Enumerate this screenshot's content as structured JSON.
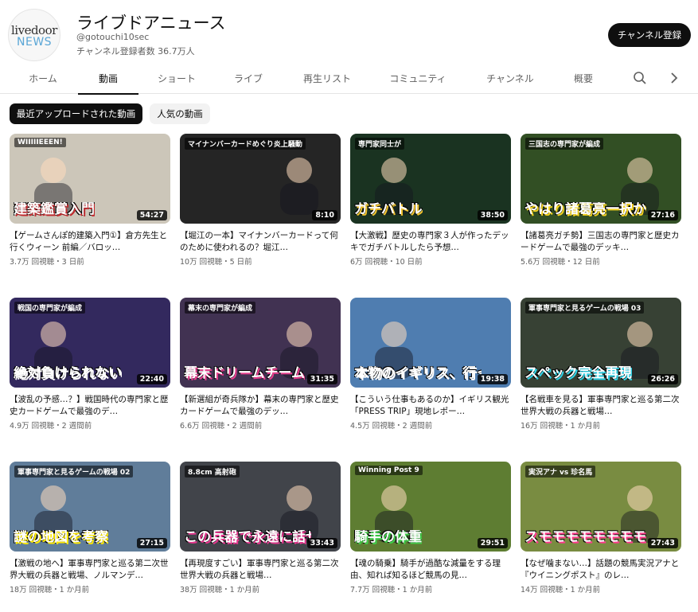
{
  "channel": {
    "logo_line1": "livedoor",
    "logo_line2": "NEWS",
    "name": "ライブドアニュース",
    "handle": "@gotouchi10sec",
    "subscribers": "チャンネル登録者数 36.7万人",
    "subscribe_label": "チャンネル登録"
  },
  "tabs": [
    {
      "label": "ホーム",
      "active": false
    },
    {
      "label": "動画",
      "active": true
    },
    {
      "label": "ショート",
      "active": false
    },
    {
      "label": "ライブ",
      "active": false
    },
    {
      "label": "再生リスト",
      "active": false
    },
    {
      "label": "コミュニティ",
      "active": false
    },
    {
      "label": "チャンネル",
      "active": false
    },
    {
      "label": "概要",
      "active": false
    }
  ],
  "icons": {
    "search": "search-icon",
    "next": "chevron-right-icon"
  },
  "chips": [
    {
      "label": "最近アップロードされた動画",
      "selected": true
    },
    {
      "label": "人気の動画",
      "selected": false
    }
  ],
  "videos": [
    {
      "title": "【ゲームさんぽ的建築入門①】倉方先生と行くウィーン 前編／バロッ…",
      "meta": "3.7万 回視聴・3 日前",
      "duration": "54:27",
      "thumb_text": "建築鑑賞入門",
      "thumb_top": "WIIIIIEEEN!",
      "thumb_bg": "#e9e2d3",
      "thumb_accent": "#c0282d"
    },
    {
      "title": "【堀江の一本】マイナンバーカードって何のために使われるの？堀江…",
      "meta": "10万 回視聴・5 日前",
      "duration": "8:10",
      "thumb_text": "",
      "thumb_top": "マイナンバーカードめぐり炎上騒動",
      "thumb_bg": "#2b2b2b",
      "thumb_accent": "#e5e5e5"
    },
    {
      "title": "【大激戦】歴史の専門家３人が作ったデッキでガチバトルしたら予想…",
      "meta": "6万 回視聴・10 日前",
      "duration": "38:50",
      "thumb_text": "ガチバトル",
      "thumb_top": "専門家同士が",
      "thumb_bg": "#1e3b26",
      "thumb_accent": "#f2c22e"
    },
    {
      "title": "【諸葛亮ガチ勢】三国志の専門家と歴史カードゲームで最強のデッキ…",
      "meta": "5.6万 回視聴・12 日前",
      "duration": "27:16",
      "thumb_text": "やはり諸葛亮一択か",
      "thumb_top": "三国志の専門家が編成",
      "thumb_bg": "#3a5a2a",
      "thumb_accent": "#f5d21f"
    },
    {
      "title": "【波乱の予感…？】戦国時代の専門家と歴史カードゲームで最強のデ…",
      "meta": "4.9万 回視聴・2 週間前",
      "duration": "22:40",
      "thumb_text": "絶対負けられない",
      "thumb_top": "戦国の専門家が編成",
      "thumb_bg": "#3b2f6b",
      "thumb_accent": "#ffffff"
    },
    {
      "title": "【新選組が奇兵隊か】幕末の専門家と歴史カードゲームで最強のデッ…",
      "meta": "6.6万 回視聴・2 週間前",
      "duration": "31:35",
      "thumb_text": "幕末ドリームチーム",
      "thumb_top": "幕末の専門家が編成",
      "thumb_bg": "#4a3a5e",
      "thumb_accent": "#e83d8d"
    },
    {
      "title": "【こういう仕事もあるのか】イギリス観光「PRESS TRIP」現地レポー…",
      "meta": "4.5万 回視聴・2 週間前",
      "duration": "19:38",
      "thumb_text": "本物のイギリス、行って来ました。",
      "thumb_top": "",
      "thumb_bg": "#5b8fc9",
      "thumb_accent": "#ffffff"
    },
    {
      "title": "【名戦車を見る】軍事専門家と巡る第二次世界大戦の兵器と戦場…",
      "meta": "16万 回視聴・1 か月前",
      "duration": "26:26",
      "thumb_text": "スペック完全再現",
      "thumb_top": "軍事専門家と見るゲームの戦場 03",
      "thumb_bg": "#3f4a3c",
      "thumb_accent": "#2fd3e8"
    },
    {
      "title": "【激戦の地へ】軍事専門家と巡る第二次世界大戦の兵器と戦場、ノルマンデ…",
      "meta": "18万 回視聴・1 か月前",
      "duration": "27:15",
      "thumb_text": "謎の地図を考察",
      "thumb_top": "軍事専門家と見るゲームの戦場 02",
      "thumb_bg": "#6e8fb0",
      "thumb_accent": "#ffea00"
    },
    {
      "title": "【再現度すごい】軍事専門家と巡る第二次世界大戦の兵器と戦場…",
      "meta": "38万 回視聴・1 か月前",
      "duration": "33:43",
      "thumb_text": "この兵器で永遠に話せる…",
      "thumb_top": "8.8cm 高射砲",
      "thumb_bg": "#4b4e55",
      "thumb_accent": "#e8368f"
    },
    {
      "title": "【魂の騎乗】騎手が過酷な減量をする理由、知れば知るほど競馬の見…",
      "meta": "7.7万 回視聴・1 か月前",
      "duration": "29:51",
      "thumb_text": "騎手の体重",
      "thumb_top": "Winning Post 9",
      "thumb_bg": "#6c8f3a",
      "thumb_accent": "#3fd04a"
    },
    {
      "title": "【なぜ噛まない…】話題の競馬実況アナと『ウイニングポスト』のレ…",
      "meta": "14万 回視聴・1 か月前",
      "duration": "27:43",
      "thumb_text": "スモモモモモモモモ",
      "thumb_top": "実況アナ vs 珍名馬",
      "thumb_bg": "#8aa04a",
      "thumb_accent": "#ff3a8d"
    }
  ]
}
